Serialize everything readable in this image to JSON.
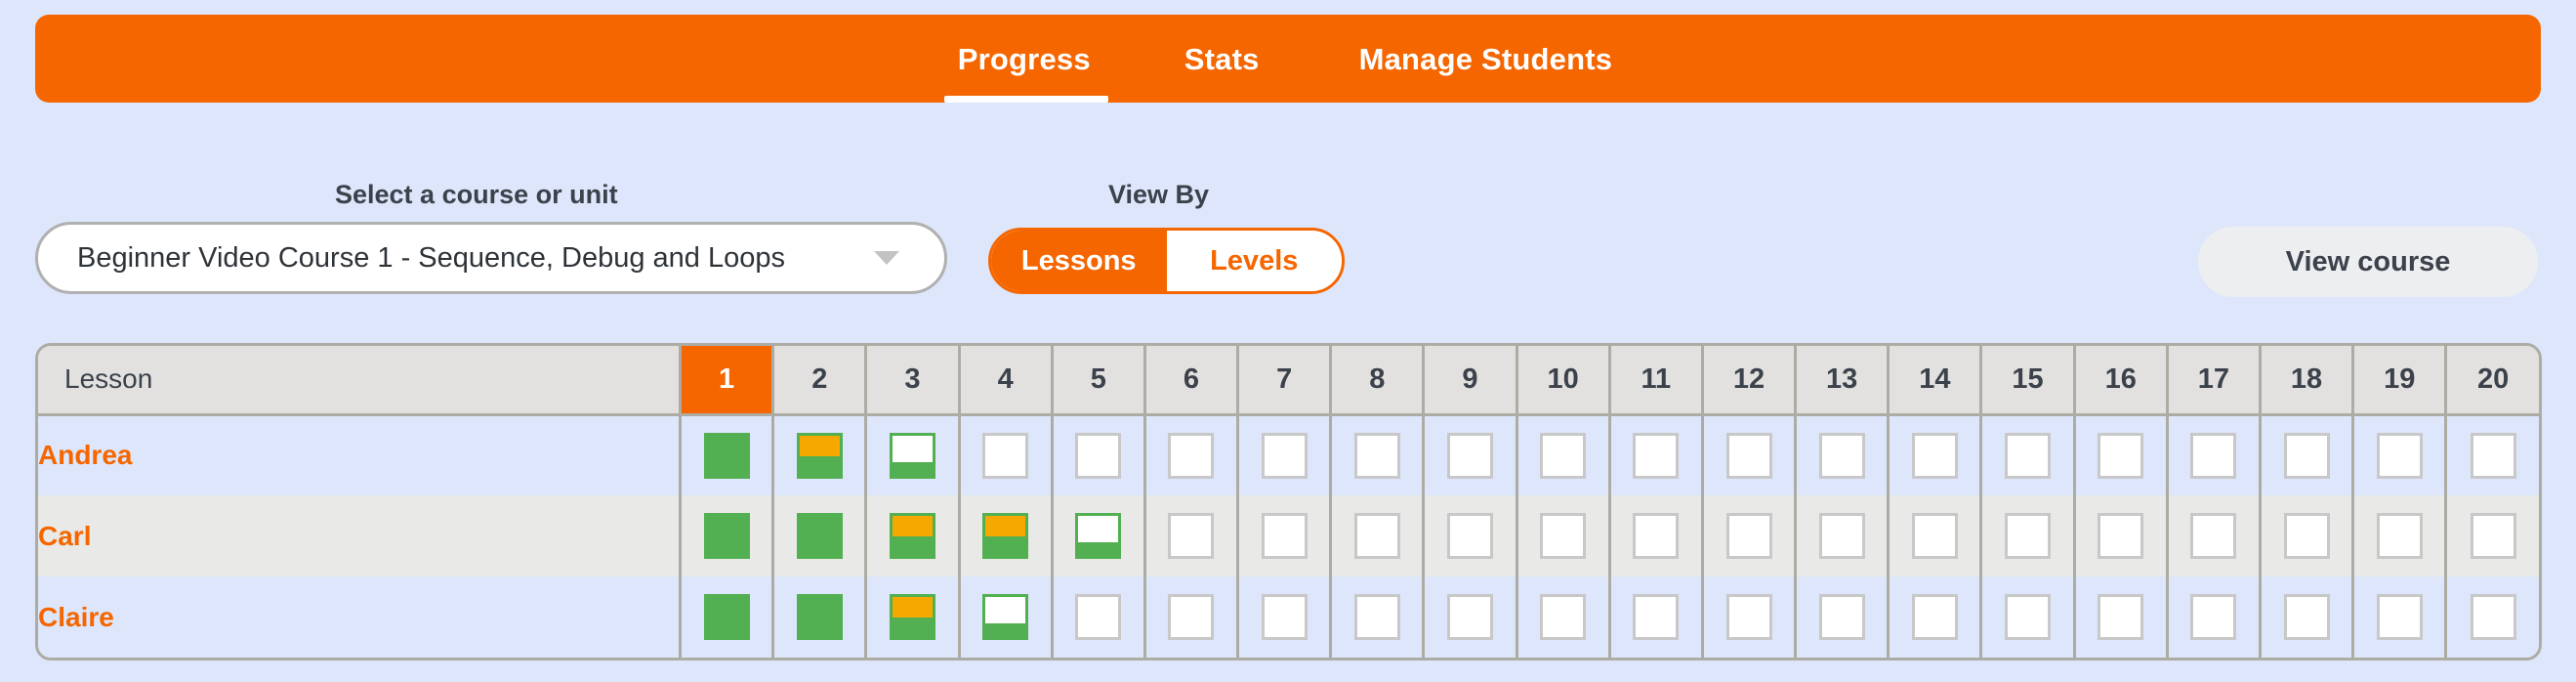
{
  "nav": {
    "tabs": [
      {
        "label": "Progress",
        "active": true
      },
      {
        "label": "Stats",
        "active": false
      },
      {
        "label": "Manage Students",
        "active": false
      }
    ]
  },
  "controls": {
    "course_label": "Select a course or unit",
    "course_value": "Beginner Video Course 1 - Sequence, Debug and Loops",
    "course_caret_icon": "chevron-down-icon",
    "viewby_label": "View By",
    "viewby_options": [
      {
        "label": "Lessons",
        "selected": true
      },
      {
        "label": "Levels",
        "selected": false
      }
    ],
    "view_course_label": "View course"
  },
  "table": {
    "first_column_header": "Lesson",
    "lesson_columns": [
      "1",
      "2",
      "3",
      "4",
      "5",
      "6",
      "7",
      "8",
      "9",
      "10",
      "11",
      "12",
      "13",
      "14",
      "15",
      "16",
      "17",
      "18",
      "19",
      "20"
    ],
    "active_column": "1",
    "rows": [
      {
        "name": "Andrea",
        "cells": [
          "full",
          "orange-partial",
          "white-partial",
          "empty",
          "empty",
          "empty",
          "empty",
          "empty",
          "empty",
          "empty",
          "empty",
          "empty",
          "empty",
          "empty",
          "empty",
          "empty",
          "empty",
          "empty",
          "empty",
          "empty"
        ]
      },
      {
        "name": "Carl",
        "cells": [
          "full",
          "full",
          "orange-partial",
          "orange-partial",
          "white-partial",
          "empty",
          "empty",
          "empty",
          "empty",
          "empty",
          "empty",
          "empty",
          "empty",
          "empty",
          "empty",
          "empty",
          "empty",
          "empty",
          "empty",
          "empty"
        ]
      },
      {
        "name": "Claire",
        "cells": [
          "full",
          "full",
          "orange-partial",
          "white-partial",
          "empty",
          "empty",
          "empty",
          "empty",
          "empty",
          "empty",
          "empty",
          "empty",
          "empty",
          "empty",
          "empty",
          "empty",
          "empty",
          "empty",
          "empty",
          "empty"
        ]
      }
    ]
  },
  "colors": {
    "brand_orange": "#f56600",
    "progress_green": "#52b052",
    "progress_orange": "#f5a800",
    "page_background": "#dde6fb",
    "row_alt_background": "#e9e9e7",
    "header_cell_background": "#e2e1df",
    "grid_line": "#adaca4",
    "empty_box_border": "#c8c8c8"
  }
}
